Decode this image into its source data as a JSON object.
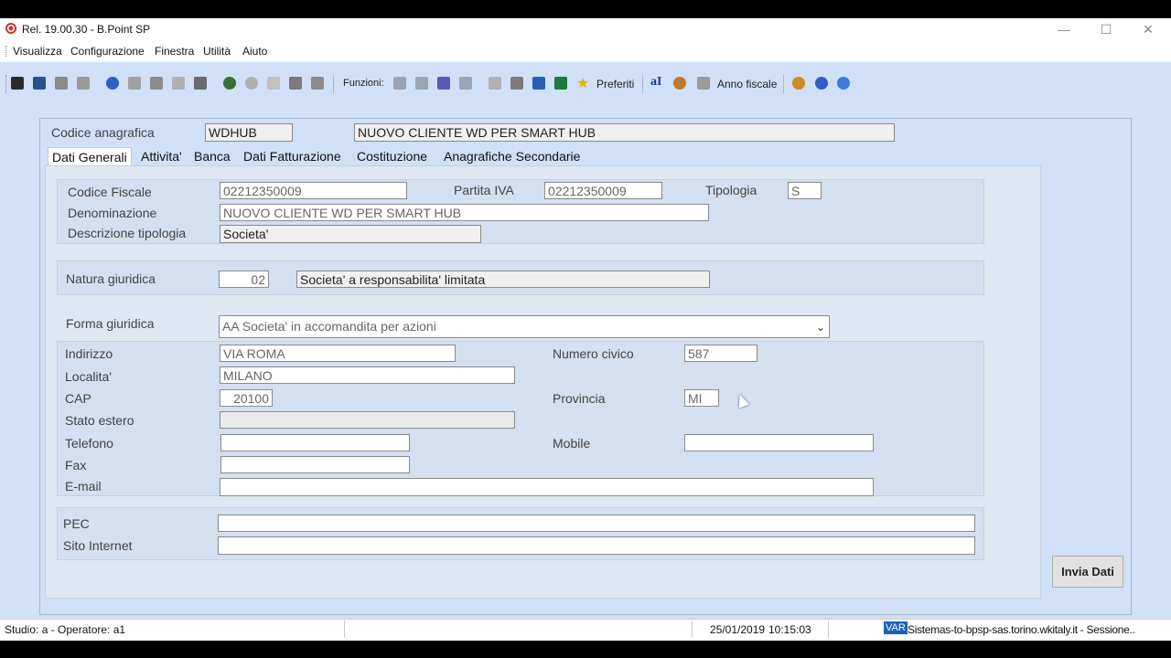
{
  "window": {
    "title": "Rel. 19.00.30 - B.Point SP"
  },
  "menu": [
    "Visualizza",
    "Configurazione",
    "Finestra",
    "Utilità",
    "Aiuto"
  ],
  "toolbar": {
    "funzioni_label": "Funzioni:",
    "preferiti_label": "Preferiti",
    "anno_fiscale_label": "Anno fiscale"
  },
  "header": {
    "codice_label": "Codice anagrafica",
    "codice_value": "WDHUB",
    "nome_value": "NUOVO CLIENTE WD PER SMART HUB"
  },
  "tabs": [
    "Dati Generali",
    "Attivita'",
    "Banca",
    "Dati Fatturazione",
    "Costituzione",
    "Anagrafiche Secondarie"
  ],
  "form": {
    "codice_fiscale": {
      "label": "Codice Fiscale",
      "value": "02212350009"
    },
    "partita_iva": {
      "label": "Partita IVA",
      "value": "02212350009"
    },
    "tipologia": {
      "label": "Tipologia",
      "value": "S"
    },
    "denominazione": {
      "label": "Denominazione",
      "value": "NUOVO CLIENTE WD PER SMART HUB"
    },
    "descrizione_tipologia": {
      "label": "Descrizione tipologia",
      "value": "Societa'"
    },
    "natura_giuridica": {
      "label": "Natura giuridica",
      "code": "02",
      "value": "Societa' a responsabilita' limitata"
    },
    "forma_giuridica": {
      "label": "Forma giuridica",
      "value": "AA Societa' in accomandita per azioni"
    },
    "indirizzo": {
      "label": "Indirizzo",
      "value": "VIA ROMA"
    },
    "numero_civico": {
      "label": "Numero civico",
      "value": "587"
    },
    "localita": {
      "label": "Localita'",
      "value": "MILANO"
    },
    "cap": {
      "label": "CAP",
      "value": "20100"
    },
    "provincia": {
      "label": "Provincia",
      "value": "MI"
    },
    "stato_estero": {
      "label": "Stato estero",
      "value": ""
    },
    "telefono": {
      "label": "Telefono",
      "value": ""
    },
    "mobile": {
      "label": "Mobile",
      "value": ""
    },
    "fax": {
      "label": "Fax",
      "value": ""
    },
    "email": {
      "label": "E-mail",
      "value": ""
    },
    "pec": {
      "label": "PEC",
      "value": ""
    },
    "sito_internet": {
      "label": "Sito Internet",
      "value": ""
    }
  },
  "buttons": {
    "invia_dati": "Invia Dati"
  },
  "status": {
    "studio": "Studio: a - Operatore: a1",
    "date": "25/01/2019",
    "time": "10:15:03",
    "var_badge": "VAR",
    "session": "Sistemas-to-bpsp-sas.torino.wkitaly.it - Sessione..."
  },
  "colors": {
    "background": "#cfe0f7",
    "tab_page": "#dfe7f2",
    "var_badge": "#1e5fbf"
  }
}
